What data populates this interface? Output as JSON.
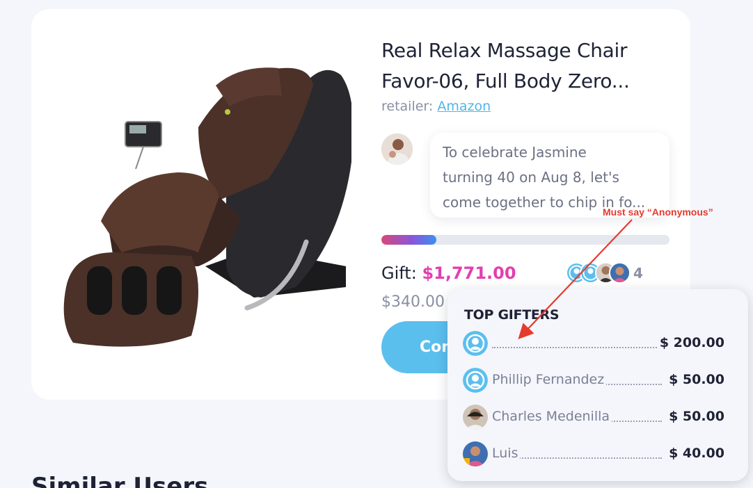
{
  "product": {
    "title_line1": "Real Relax Massage Chair",
    "title_line2": "Favor-06, Full Body Zero...",
    "retailer_label": "retailer:",
    "retailer_name": "Amazon"
  },
  "message": {
    "line1": "To celebrate Jasmine",
    "line2": "turning 40 on Aug 8, let's",
    "line3": "come together to chip in fo..."
  },
  "funding": {
    "progress_percent": 19,
    "gift_label": "Gift:",
    "gift_amount": "$1,771.00",
    "raised_amount": "$340.00",
    "gifter_count": "4",
    "contribute_label": "Contribute"
  },
  "similar_heading": "Similar Users",
  "top_gifters": {
    "title": "TOP GIFTERS",
    "rows": [
      {
        "name": "",
        "amount": "$ 200.00",
        "avatar": "user-icon"
      },
      {
        "name": "Phillip Fernandez",
        "amount": "$ 50.00",
        "avatar": "user-icon"
      },
      {
        "name": "Charles Medenilla",
        "amount": "$ 50.00",
        "avatar": "photo"
      },
      {
        "name": "Luis",
        "amount": "$ 40.00",
        "avatar": "photo"
      }
    ]
  },
  "annotation": {
    "text": "Must say “Anonymous”",
    "color": "#e53a2d"
  },
  "colors": {
    "accent": "#5bbfee",
    "gift_amount": "#e23fb0",
    "link": "#4fb6e8"
  }
}
